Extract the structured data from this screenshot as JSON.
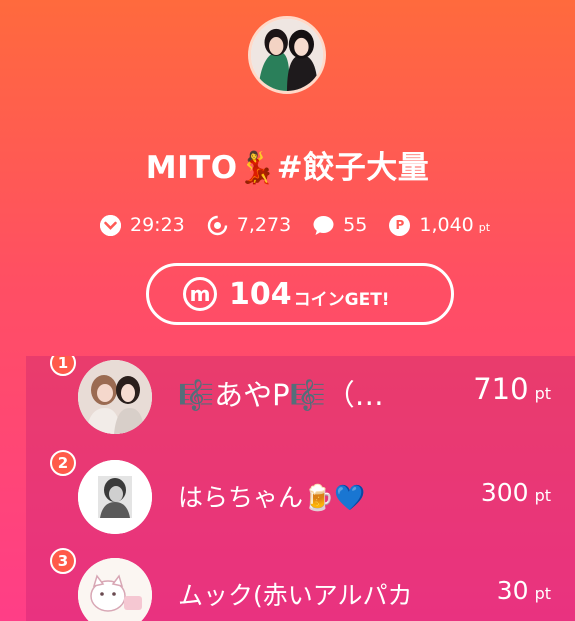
{
  "host": {
    "title": "MITO💃#餃子大量"
  },
  "stats": {
    "time": "29:23",
    "viewers": "7,273",
    "comments": "55",
    "points": "1,040",
    "points_unit": "pt"
  },
  "coin_button": {
    "amount": "104",
    "label": "コインGET!"
  },
  "ranking": [
    {
      "rank": "1",
      "name": "🎼あやP🎼（…",
      "points": "710",
      "unit": "pt"
    },
    {
      "rank": "2",
      "name": "はらちゃん🍺💙",
      "points": "300",
      "unit": "pt"
    },
    {
      "rank": "3",
      "name": "ムック(赤いアルパカ",
      "points": "30",
      "unit": "pt"
    }
  ],
  "colors": {
    "gradient_top": "#ff6a3d",
    "gradient_bottom": "#ff3e87",
    "badge": "#ff5a4a"
  },
  "icons": {
    "time": "chevron-down-icon",
    "viewers": "eye-icon",
    "comments": "speech-bubble-icon",
    "points": "p-coin-icon",
    "coin": "m-coin-icon"
  }
}
